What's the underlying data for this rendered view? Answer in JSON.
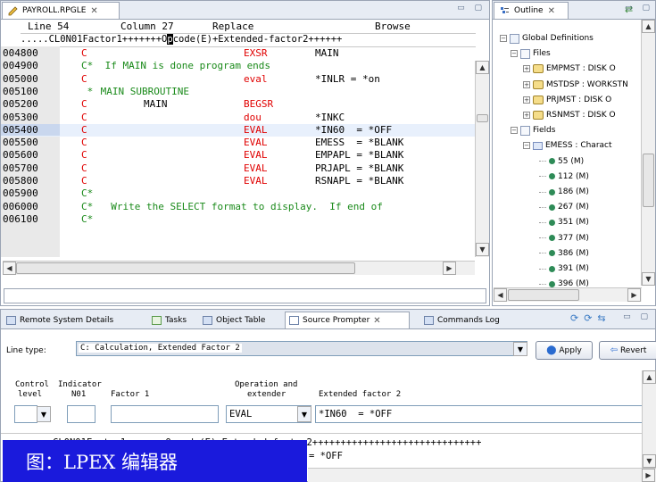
{
  "editor": {
    "tab_title": "PAYROLL.RPGLE",
    "status": {
      "line": "Line 54",
      "column": "Column 27",
      "mode": "Replace",
      "browse": "Browse"
    },
    "ruler_before": ".....CL0N01Factor1+++++++O",
    "ruler_cursor": "p",
    "ruler_after": "code(E)+Extended-factor2++++++",
    "rows": [
      {
        "ln": "004800",
        "c": "C",
        "c_color": "red",
        "op": "EXSR",
        "op_color": "red",
        "f2": "MAIN",
        "cm": ""
      },
      {
        "ln": "004900",
        "c": "C*",
        "c_color": "green",
        "op": "",
        "op_color": "red",
        "f2": "",
        "cm": " If MAIN is done program ends"
      },
      {
        "ln": "005000",
        "c": "C",
        "c_color": "red",
        "op": "eval",
        "op_color": "red",
        "f2": "*INLR = *on",
        "cm": ""
      },
      {
        "ln": "005100",
        "c": " *",
        "c_color": "green",
        "op": "",
        "op_color": "red",
        "f2": "",
        "cm": " MAIN SUBROUTINE"
      },
      {
        "ln": "005200",
        "c": "C",
        "c_color": "red",
        "f1": "MAIN",
        "op": "BEGSR",
        "op_color": "red",
        "f2": "",
        "cm": ""
      },
      {
        "ln": "005300",
        "c": "C",
        "c_color": "red",
        "op": "dou",
        "op_color": "red",
        "f2": "*INKC",
        "cm": ""
      },
      {
        "ln": "005400",
        "c": "C",
        "c_color": "red",
        "op": "EVAL",
        "op_color": "red",
        "f2": "*IN60  = *OFF",
        "cm": "",
        "highlight": true
      },
      {
        "ln": "005500",
        "c": "C",
        "c_color": "red",
        "op": "EVAL",
        "op_color": "red",
        "f2": "EMESS  = *BLANK",
        "cm": ""
      },
      {
        "ln": "005600",
        "c": "C",
        "c_color": "red",
        "op": "EVAL",
        "op_color": "red",
        "f2": "EMPAPL = *BLANK",
        "cm": ""
      },
      {
        "ln": "005700",
        "c": "C",
        "c_color": "red",
        "op": "EVAL",
        "op_color": "red",
        "f2": "PRJAPL = *BLANK",
        "cm": ""
      },
      {
        "ln": "005800",
        "c": "C",
        "c_color": "red",
        "op": "EVAL",
        "op_color": "red",
        "f2": "RSNAPL = *BLANK",
        "cm": ""
      },
      {
        "ln": "005900",
        "c": "C*",
        "c_color": "green",
        "op": "",
        "op_color": "red",
        "f2": "",
        "cm": ""
      },
      {
        "ln": "006000",
        "c": "C*",
        "c_color": "green",
        "op": "",
        "op_color": "red",
        "f2": "",
        "cm": "  Write the SELECT format to display.  If end of"
      },
      {
        "ln": "006100",
        "c": "C*",
        "c_color": "green",
        "op": "",
        "op_color": "red",
        "f2": "",
        "cm": ""
      }
    ]
  },
  "outline": {
    "tab_title": "Outline",
    "items": [
      {
        "label": "Global Definitions",
        "icon": "folder-icon"
      },
      {
        "label": "Files",
        "icon": "files-icon"
      },
      {
        "label": "EMPMST : DISK O",
        "icon": "record-icon"
      },
      {
        "label": "MSTDSP : WORKSTN",
        "icon": "record-icon"
      },
      {
        "label": "PRJMST : DISK O",
        "icon": "record-icon"
      },
      {
        "label": "RSNMST : DISK O",
        "icon": "record-icon"
      },
      {
        "label": "Fields",
        "icon": "fields-icon"
      },
      {
        "label": "EMESS : Charact",
        "icon": "field-icon"
      },
      {
        "label": "55 (M)",
        "icon": "dot-icon"
      },
      {
        "label": "112 (M)",
        "icon": "dot-icon"
      },
      {
        "label": "186 (M)",
        "icon": "dot-icon"
      },
      {
        "label": "267 (M)",
        "icon": "dot-icon"
      },
      {
        "label": "351 (M)",
        "icon": "dot-icon"
      },
      {
        "label": "377 (M)",
        "icon": "dot-icon"
      },
      {
        "label": "386 (M)",
        "icon": "dot-icon"
      },
      {
        "label": "391 (M)",
        "icon": "dot-icon"
      },
      {
        "label": "396 (M)",
        "icon": "dot-icon"
      }
    ]
  },
  "bottom": {
    "tabs": [
      {
        "label": "Remote System Details"
      },
      {
        "label": "Tasks"
      },
      {
        "label": "Object Table"
      },
      {
        "label": "Source Prompter"
      },
      {
        "label": "Commands Log"
      }
    ],
    "line_type_label": "Line type:",
    "line_type_value": "C: Calculation, Extended Factor 2",
    "apply_label": "Apply",
    "revert_label": "Revert",
    "header_control": "Control",
    "header_level": "level",
    "header_indicator": "Indicator",
    "header_n01": "N01",
    "header_factor1": "Factor 1",
    "header_operation": "Operation and",
    "header_extender": "extender",
    "header_extfactor2": "Extended factor 2",
    "operation_value": "EVAL",
    "extfactor2_value": "*IN60  = *OFF",
    "preview_line1": "CL0N01Factor1+++++++Opcode(E)+Extended-factor2++++++++++++++++++++++++++++++",
    "preview_line2": "= *OFF"
  },
  "caption": "图：LPEX 编辑器"
}
